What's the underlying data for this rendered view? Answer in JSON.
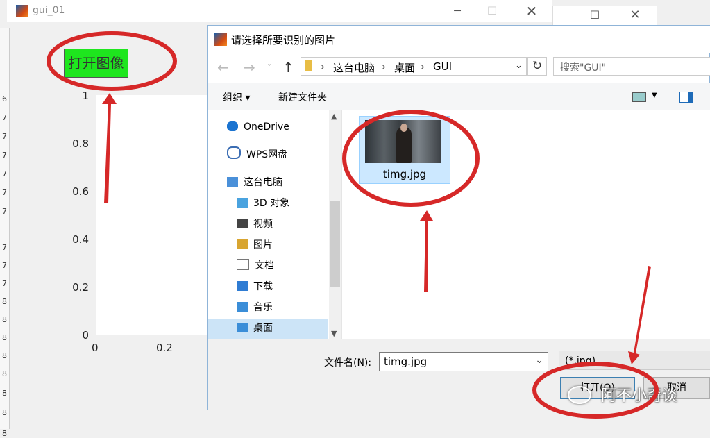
{
  "background_window": {
    "title": "gui_01",
    "left_numbers": [
      "6",
      "7",
      "7",
      "7",
      "7",
      "7",
      "7",
      "7",
      "7",
      "7",
      "8",
      "8",
      "8",
      "8",
      "8",
      "8",
      "8",
      "8"
    ]
  },
  "gui": {
    "open_button_label": "打开图像",
    "y_ticks": [
      "1",
      "0.8",
      "0.6",
      "0.4",
      "0.2",
      "0"
    ],
    "x_ticks": [
      "0",
      "0.2"
    ]
  },
  "dialog": {
    "title": "请选择所要识别的图片",
    "breadcrumb": [
      "这台电脑",
      "桌面",
      "GUI"
    ],
    "search_placeholder": "搜索\"GUI\"",
    "toolbar": {
      "organize": "组织 ▾",
      "new_folder": "新建文件夹"
    },
    "nav_items": [
      {
        "label": "OneDrive",
        "icon": "cloud-icon",
        "color": "#1a73d0"
      },
      {
        "label": "WPS网盘",
        "icon": "cloud-outline-icon",
        "color": "#3b6db3"
      },
      {
        "label": "这台电脑",
        "icon": "computer-icon",
        "color": "#4a90d9"
      },
      {
        "label": "3D 对象",
        "icon": "cube-folder-icon",
        "color": "#4aa3df"
      },
      {
        "label": "视频",
        "icon": "film-icon",
        "color": "#444444"
      },
      {
        "label": "图片",
        "icon": "picture-folder-icon",
        "color": "#d8a531"
      },
      {
        "label": "文档",
        "icon": "document-icon",
        "color": "#777777"
      },
      {
        "label": "下载",
        "icon": "download-folder-icon",
        "color": "#2f7cd3"
      },
      {
        "label": "音乐",
        "icon": "music-folder-icon",
        "color": "#3b8ed8"
      },
      {
        "label": "桌面",
        "icon": "desktop-folder-icon",
        "color": "#3b8ed8"
      }
    ],
    "selected_file": "timg.jpg",
    "filename_label": "文件名(N):",
    "filename_value": "timg.jpg",
    "filter": "(*.jpg)",
    "open_button": "打开(O)",
    "cancel_button": "取消"
  },
  "watermark": "阿不小奇谈",
  "annotation_color": "#d62828"
}
